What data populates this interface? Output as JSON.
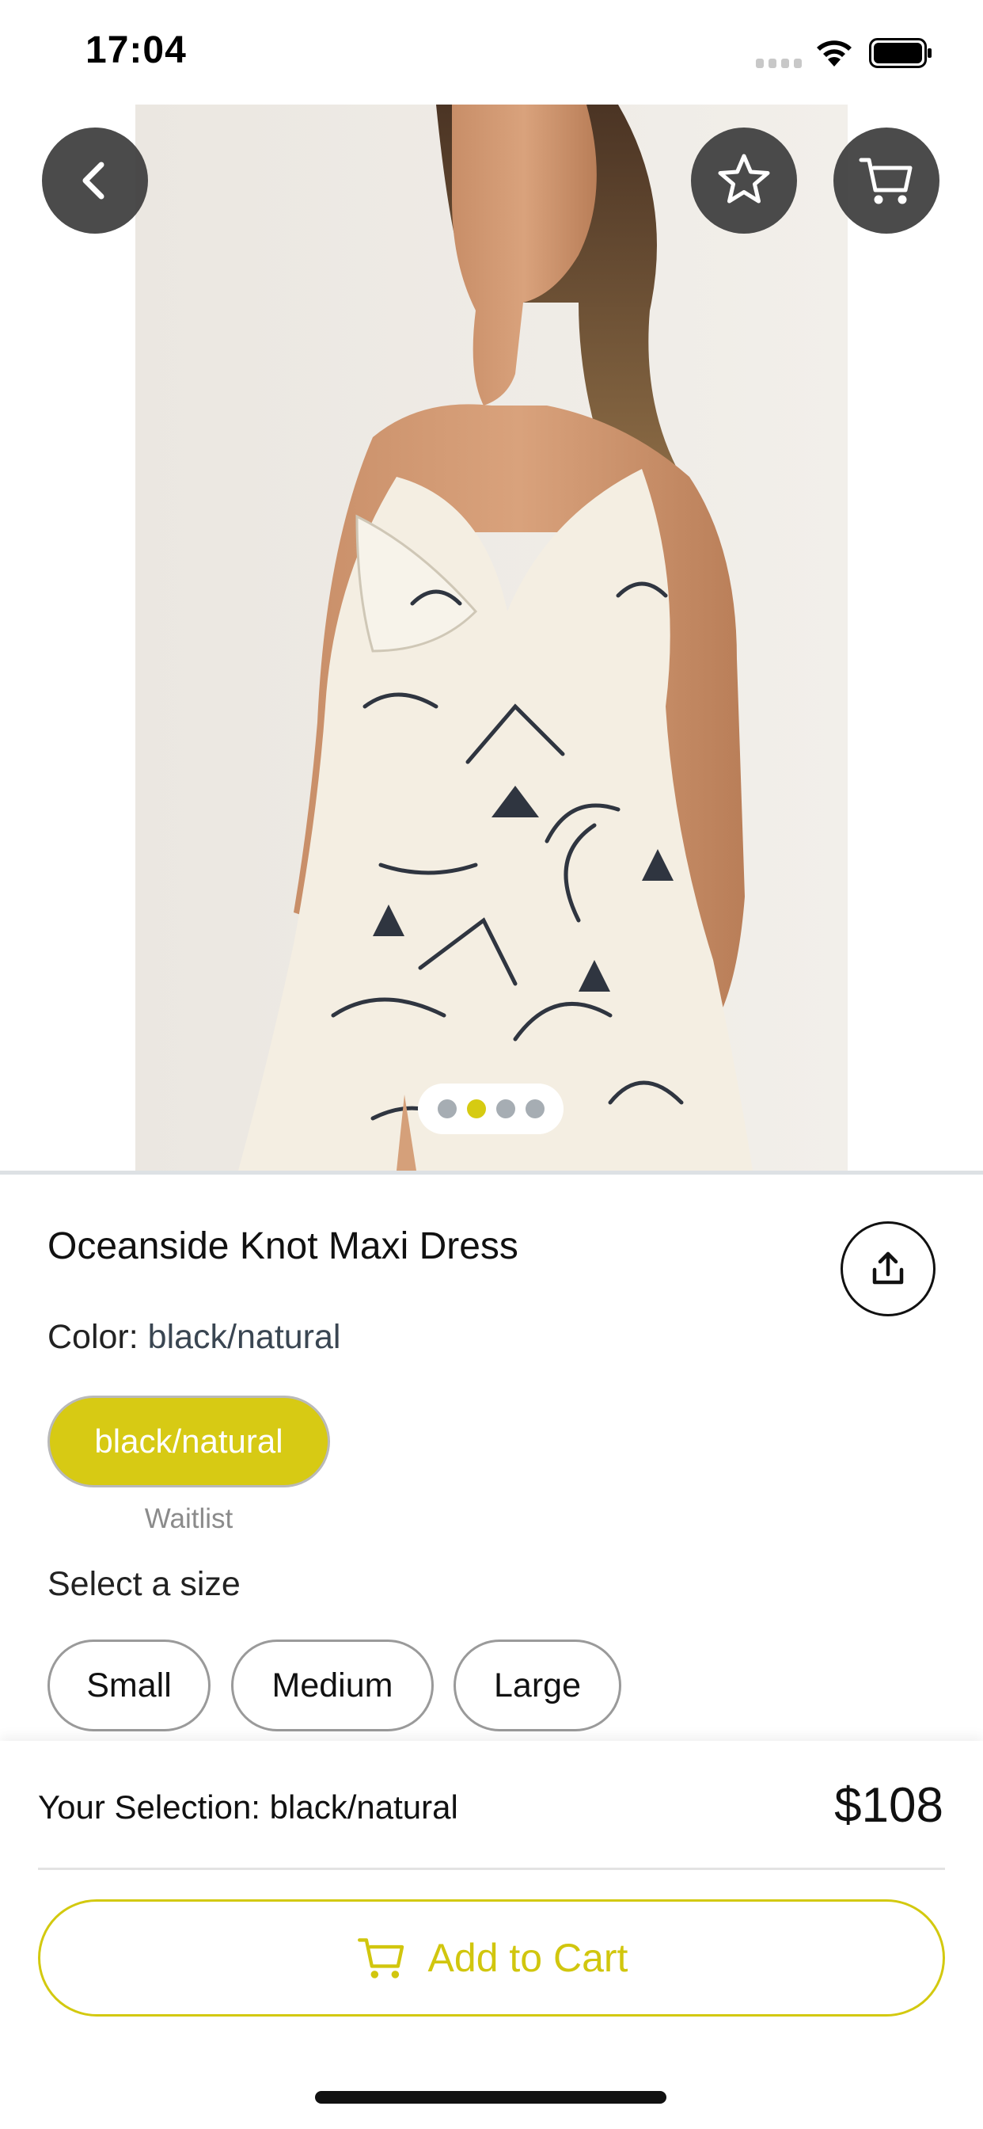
{
  "status_bar": {
    "time": "17:04"
  },
  "colors": {
    "accent": "#d7ca14",
    "button_overlay": "#3c3c3c",
    "dot_inactive": "#a6adb3"
  },
  "hero": {
    "icons": {
      "back": "chevron-left-icon",
      "favorite": "star-icon",
      "cart": "cart-icon"
    },
    "carousel": {
      "page_count": 4,
      "active_index": 1
    }
  },
  "product": {
    "title": "Oceanside Knot Maxi Dress",
    "color_label": "Color: ",
    "color_value": "black/natural",
    "swatch_label": "black/natural",
    "swatch_status": "Waitlist",
    "size_heading": "Select a size",
    "sizes": [
      "Small",
      "Medium",
      "Large"
    ],
    "share_icon": "share-upload-icon"
  },
  "footer": {
    "selection_label": "Your Selection: black/natural",
    "price": "$108",
    "add_to_cart_label": "Add to Cart"
  }
}
